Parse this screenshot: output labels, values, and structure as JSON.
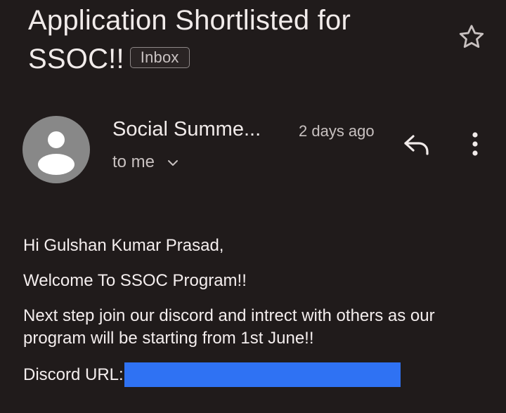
{
  "email": {
    "subject": "Application Shortlisted for SSOC!!",
    "label": "Inbox",
    "sender_name": "Social Summe...",
    "time": "2 days ago",
    "recipient": "to me",
    "body": {
      "greeting": "Hi Gulshan Kumar Prasad,",
      "welcome": "Welcome To SSOC Program!!",
      "next_step": "Next step join our discord and intrect with others as our program will be starting from 1st June!!",
      "discord_label": "Discord URL:"
    }
  },
  "icons": {
    "star": "star-outline-icon",
    "avatar": "person-icon",
    "recipient_toggle": "chevron-down-icon",
    "reply": "reply-icon",
    "more": "more-vertical-icon"
  },
  "colors": {
    "background": "#201b1b",
    "text": "#f3eded",
    "secondary_text": "#c8c1c0",
    "avatar": "#888888",
    "link_highlight": "#2f72f3"
  }
}
